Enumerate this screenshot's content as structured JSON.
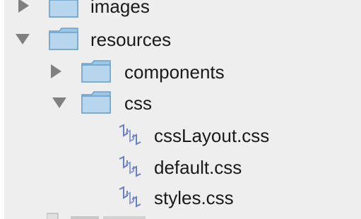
{
  "tree": {
    "items": [
      {
        "label": "images",
        "type": "folder",
        "state": "collapsed"
      },
      {
        "label": "resources",
        "type": "folder",
        "state": "expanded"
      },
      {
        "label": "components",
        "type": "folder",
        "state": "collapsed"
      },
      {
        "label": "css",
        "type": "folder",
        "state": "expanded"
      },
      {
        "label": "cssLayout.css",
        "type": "file",
        "icon": "css-file-icon"
      },
      {
        "label": "default.css",
        "type": "file",
        "icon": "css-file-icon"
      },
      {
        "label": "styles.css",
        "type": "file",
        "icon": "css-file-icon"
      }
    ]
  },
  "colors": {
    "panel_bg": "#eeeeee",
    "folder_body": "#9cc6e6",
    "folder_edge": "#6d9fc8",
    "disclosure": "#808080",
    "file_icon": "#6a7fbf",
    "text": "#1a1a1a"
  }
}
